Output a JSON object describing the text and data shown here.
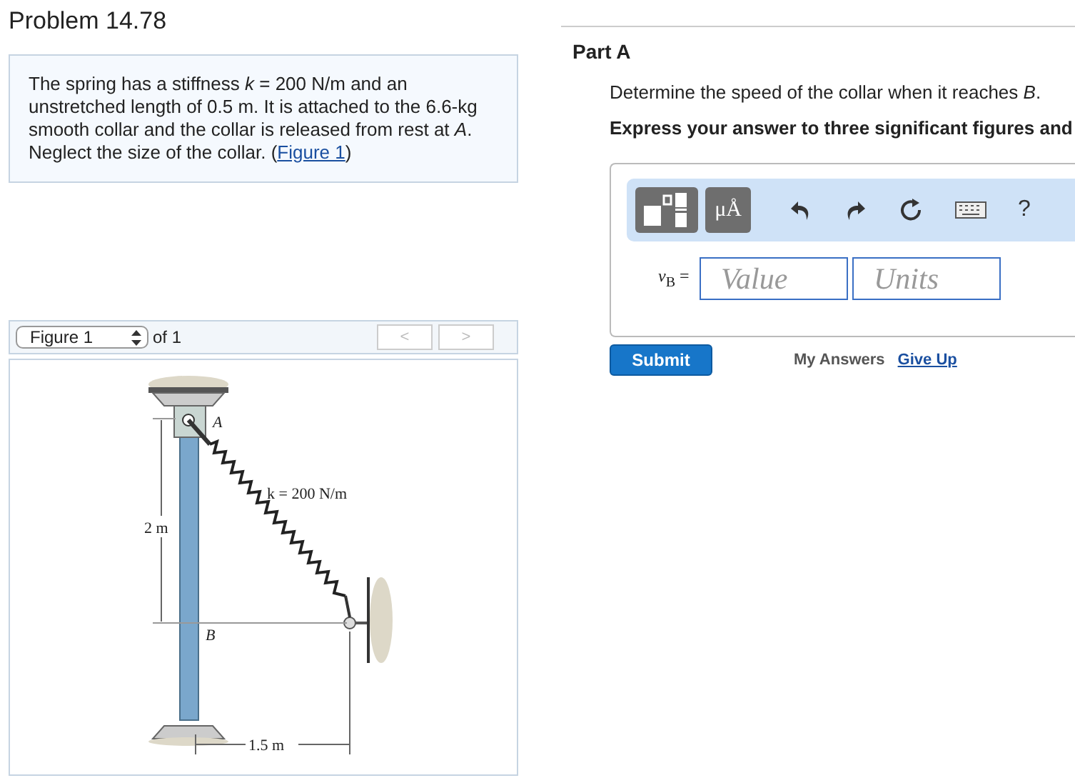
{
  "title": "Problem 14.78",
  "problem": {
    "text": "The spring has a stiffness *k* = 200 N/m and an unstretched length of 0.5 m. It is attached to the 6.6-kg smooth collar and the collar is released from rest at *A*. Neglect the size of the collar. (",
    "link": "Figure 1",
    "text_after": ")"
  },
  "figure_nav": {
    "select": "Figure 1",
    "of": "of 1",
    "prev": "<",
    "next": ">",
    "prev_disabled": true,
    "next_disabled": true
  },
  "figure": {
    "label_a": "A",
    "label_b": "B",
    "spring": "k = 200 N/m",
    "height": "2 m",
    "width": "1.5 m"
  },
  "part": {
    "title": "Part A",
    "question": "Determine the speed of the collar when it reaches *B*.",
    "instruction": "Express your answer to three significant figures and",
    "toolbar": {
      "units_button": "μÅ",
      "help": "?"
    },
    "variable": "*v*$_{B}$ =",
    "value_placeholder": "Value",
    "units_placeholder": "Units",
    "submit": "Submit",
    "my_answers": "My Answers",
    "give_up": "Give Up"
  }
}
